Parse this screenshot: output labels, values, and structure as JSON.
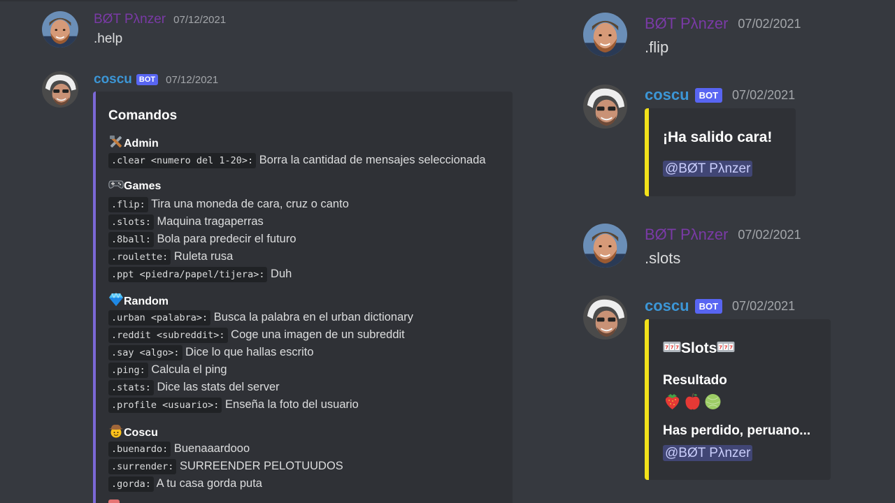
{
  "users": {
    "panzer": "BØT Pλnzer",
    "coscu": "coscu",
    "bot_badge": "BOT"
  },
  "left": {
    "msg1": {
      "date": "07/12/2021",
      "text": ".help"
    },
    "msg2": {
      "date": "07/12/2021",
      "embed_title": "Comandos",
      "sections": [
        {
          "title": "Admin",
          "icon": "tools-icon",
          "items": [
            {
              "cmd": ".clear <numero del 1-20>:",
              "desc": "Borra la cantidad de mensajes seleccionada"
            }
          ]
        },
        {
          "title": "Games",
          "icon": "game-controller-icon",
          "items": [
            {
              "cmd": ".flip:",
              "desc": "Tira una moneda de cara, cruz o canto"
            },
            {
              "cmd": ".slots:",
              "desc": "Maquina tragaperras"
            },
            {
              "cmd": ".8ball:",
              "desc": "Bola para predecir el futuro"
            },
            {
              "cmd": ".roulette:",
              "desc": "Ruleta rusa"
            },
            {
              "cmd": ".ppt <piedra/papel/tijera>:",
              "desc": "Duh"
            }
          ]
        },
        {
          "title": "Random",
          "icon": "gem-icon",
          "items": [
            {
              "cmd": ".urban <palabra>:",
              "desc": "Busca la palabra en el urban dictionary"
            },
            {
              "cmd": ".reddit <subreddit>:",
              "desc": "Coge una imagen de un subreddit"
            },
            {
              "cmd": ".say <algo>:",
              "desc": "Dice lo que hallas escrito"
            },
            {
              "cmd": ".ping:",
              "desc": "Calcula el ping"
            },
            {
              "cmd": ".stats:",
              "desc": "Dice las stats del server"
            },
            {
              "cmd": ".profile <usuario>:",
              "desc": "Enseña la foto del usuario"
            }
          ]
        },
        {
          "title": "Coscu",
          "icon": "cowboy-face-icon",
          "items": [
            {
              "cmd": ".buenardo:",
              "desc": "Buenaaardooo"
            },
            {
              "cmd": ".surrender:",
              "desc": "SURREENDER PELOTUUDOS"
            },
            {
              "cmd": ".gorda:",
              "desc": "A tu casa gorda puta"
            }
          ]
        }
      ]
    }
  },
  "right": {
    "msg1": {
      "date": "07/02/2021",
      "text": ".flip"
    },
    "msg2": {
      "date": "07/02/2021",
      "embed_title": "¡Ha salido cara!",
      "mention": "@BØT Pλnzer"
    },
    "msg3": {
      "date": "07/02/2021",
      "text": ".slots"
    },
    "msg4": {
      "date": "07/02/2021",
      "embed_title": "Slots",
      "title_icon": "slot-machine-icon",
      "field_name": "Resultado",
      "result_icons": [
        "strawberry-icon",
        "apple-icon",
        "melon-icon"
      ],
      "outcome": "Has perdido, peruano...",
      "mention": "@BØT Pλnzer"
    }
  },
  "colors": {
    "background": "#36393f",
    "embed_bg": "#2f3136",
    "embed_bar_purple": "#7b68d6",
    "embed_bar_yellow": "#f2e11a",
    "bot_badge": "#5865f2",
    "mention_bg": "#414675",
    "panzer_name": "#7a3aa6",
    "coscu_name": "#3c96d6"
  }
}
